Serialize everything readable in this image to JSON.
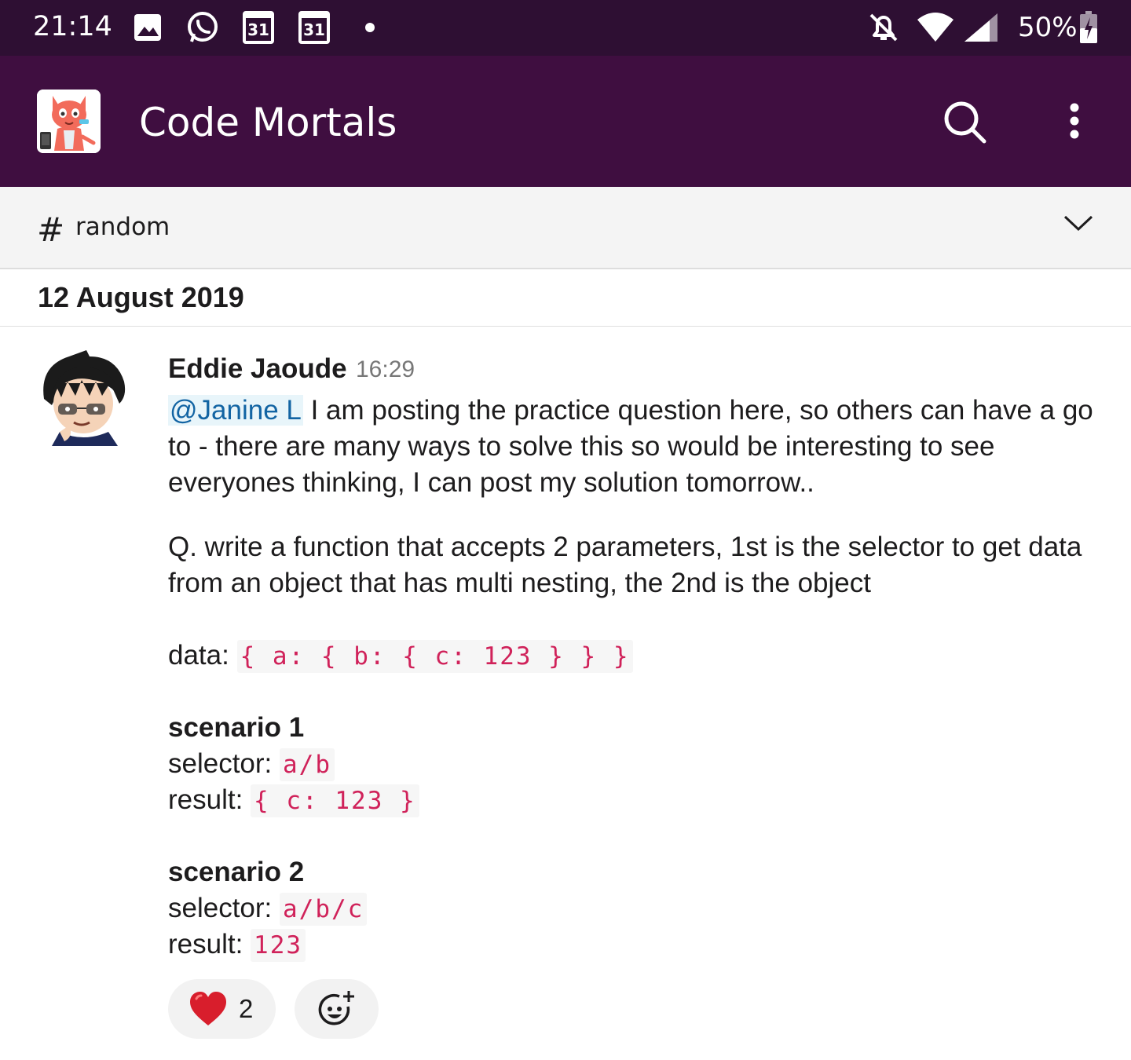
{
  "status_bar": {
    "time": "21:14",
    "cal1": "31",
    "cal2": "31",
    "battery": "50%",
    "icons": [
      "image-icon",
      "whatsapp-icon",
      "calendar-icon",
      "calendar-icon",
      "dot-icon",
      "bell-off-icon",
      "wifi-icon",
      "signal-icon",
      "battery-charging-icon"
    ]
  },
  "header": {
    "workspace_name": "Code Mortals",
    "icons": [
      "search-icon",
      "more-vert-icon"
    ]
  },
  "channel": {
    "hash": "#",
    "name": "random",
    "icon": "chevron-down-icon"
  },
  "date_divider": "12 August 2019",
  "message": {
    "author": "Eddie Jaoude",
    "time": "16:29",
    "mention": "@Janine L",
    "para1_rest": " I am posting the practice question here, so others can have a go to - there are many ways to solve this so would be interesting to see everyones thinking, I can post my solution tomorrow..",
    "question": "Q. write a function that accepts 2 parameters, 1st is the selector to get data from an object that has multi nesting, the 2nd is the object",
    "data_label": "data: ",
    "data_code": "{ a: { b: { c: 123 } } }",
    "scenarios": [
      {
        "title": "scenario 1",
        "selector_label": "selector: ",
        "selector": "a/b",
        "result_label": "result: ",
        "result": "{ c: 123 }"
      },
      {
        "title": "scenario 2",
        "selector_label": "selector: ",
        "selector": "a/b/c",
        "result_label": "result: ",
        "result": "123"
      }
    ]
  },
  "reactions": [
    {
      "emoji": "heart",
      "count": "2"
    }
  ],
  "colors": {
    "status_bar": "#2e0f33",
    "header": "#3f0e40",
    "mention_text": "#1264a3",
    "mention_bg": "#e8f5fa",
    "code_text": "#d0225a"
  }
}
